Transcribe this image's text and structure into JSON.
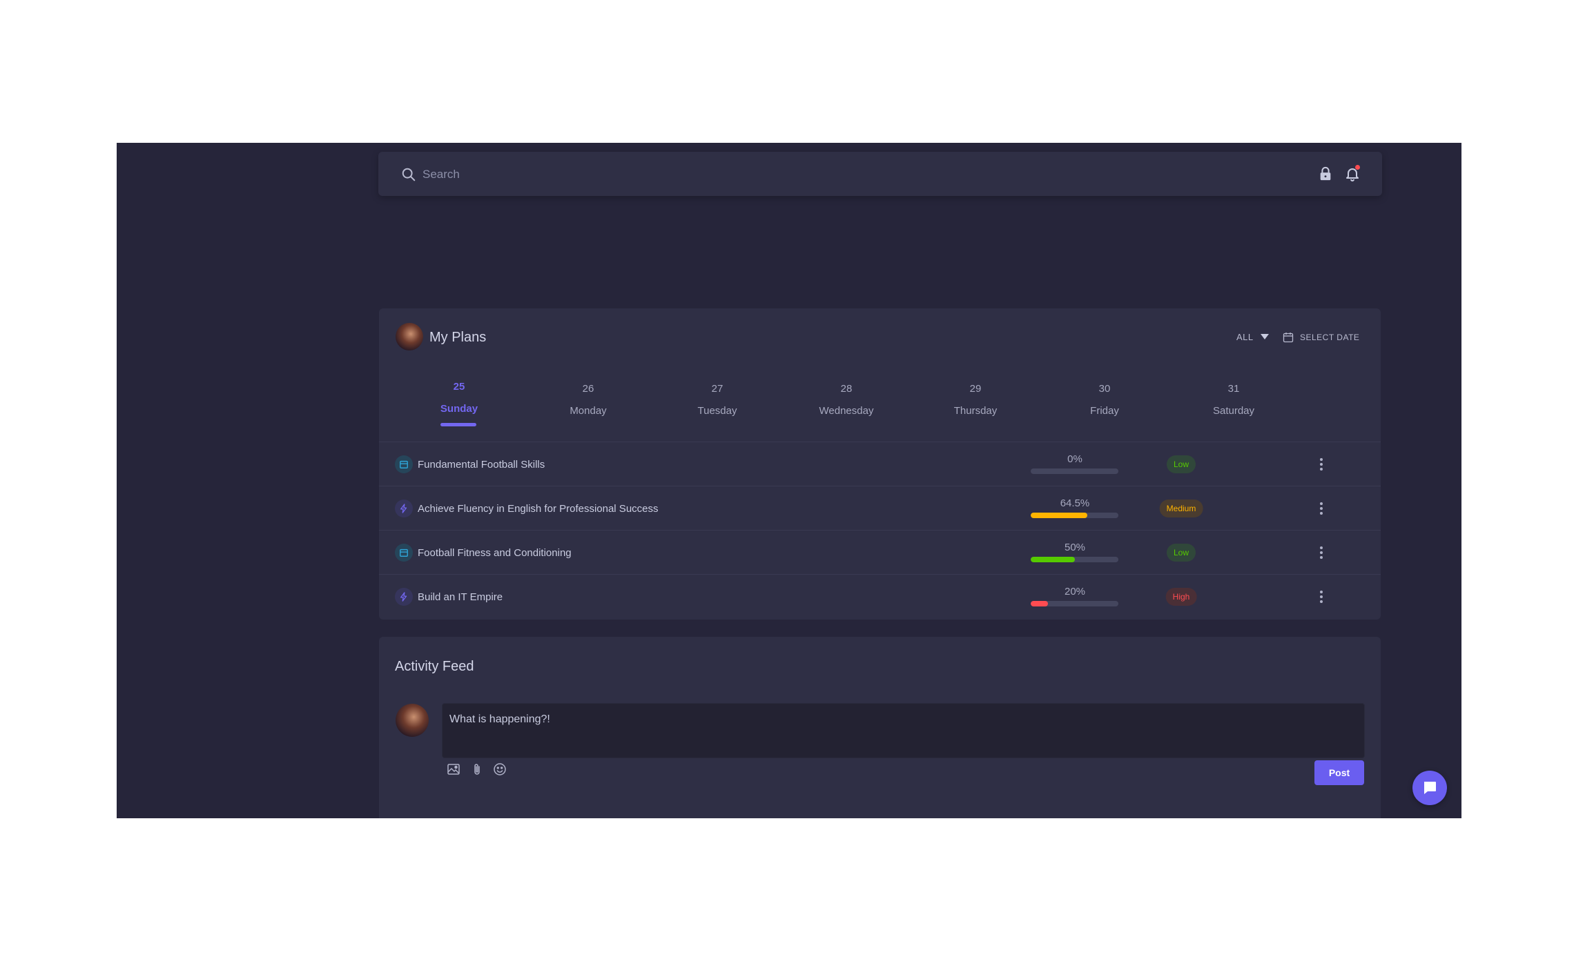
{
  "search": {
    "placeholder": "Search"
  },
  "header_icons": [
    "lock-icon",
    "bell-icon"
  ],
  "plans": {
    "title": "My Plans",
    "filter_label": "ALL",
    "select_date_label": "SELECT DATE",
    "days": [
      {
        "num": "25",
        "name": "Sunday",
        "active": true
      },
      {
        "num": "26",
        "name": "Monday",
        "active": false
      },
      {
        "num": "27",
        "name": "Tuesday",
        "active": false
      },
      {
        "num": "28",
        "name": "Wednesday",
        "active": false
      },
      {
        "num": "29",
        "name": "Thursday",
        "active": false
      },
      {
        "num": "30",
        "name": "Friday",
        "active": false
      },
      {
        "num": "31",
        "name": "Saturday",
        "active": false
      }
    ],
    "rows": [
      {
        "title": "Fundamental Football Skills",
        "icon": "calendar-icon",
        "progress_label": "0%",
        "progress": 0,
        "priority": "Low",
        "color": "#56ca00"
      },
      {
        "title": "Achieve Fluency in English for Professional Success",
        "icon": "bolt-icon",
        "progress_label": "64.5%",
        "progress": 64.5,
        "priority": "Medium",
        "color": "#ffb400"
      },
      {
        "title": "Football Fitness and Conditioning",
        "icon": "calendar-icon",
        "progress_label": "50%",
        "progress": 50,
        "priority": "Low",
        "color": "#56ca00"
      },
      {
        "title": "Build an IT Empire",
        "icon": "bolt-icon",
        "progress_label": "20%",
        "progress": 20,
        "priority": "High",
        "color": "#ff4c51"
      }
    ]
  },
  "feed": {
    "title": "Activity Feed",
    "placeholder": "What is happening?!",
    "post_label": "Post",
    "tools": [
      "image-icon",
      "paperclip-icon",
      "emoji-icon"
    ]
  },
  "colors": {
    "accent": "#7367f0",
    "panel": "#2f2f45",
    "background": "#26253a"
  }
}
